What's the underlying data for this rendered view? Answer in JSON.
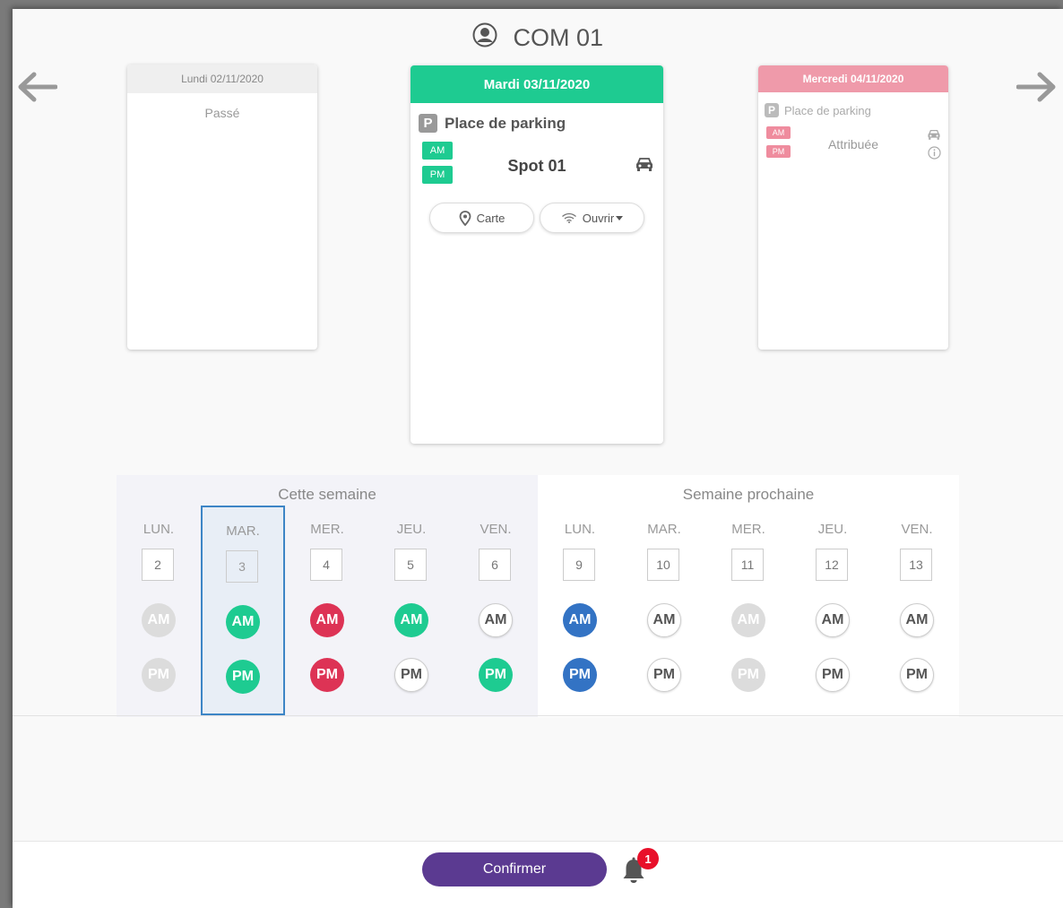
{
  "header": {
    "title": "COM 01",
    "icon": "user-circle-icon"
  },
  "cards": {
    "past": {
      "date": "Lundi 02/11/2020",
      "label": "Passé"
    },
    "current": {
      "date": "Mardi 03/11/2020",
      "service_icon": "P",
      "service": "Place de parking",
      "am": "AM",
      "pm": "PM",
      "spot": "Spot 01",
      "carte_label": "Carte",
      "ouvrir_label": "Ouvrir"
    },
    "next": {
      "date": "Mercredi 04/11/2020",
      "service_icon": "P",
      "service": "Place de parking",
      "am": "AM",
      "pm": "PM",
      "status": "Attribuée"
    }
  },
  "calendar": {
    "this_week": {
      "title": "Cette semaine",
      "days": [
        {
          "name": "LUN.",
          "num": "2",
          "am": "AM",
          "am_state": "past",
          "pm": "PM",
          "pm_state": "past"
        },
        {
          "name": "MAR.",
          "num": "3",
          "am": "AM",
          "am_state": "green",
          "pm": "PM",
          "pm_state": "green",
          "selected": true
        },
        {
          "name": "MER.",
          "num": "4",
          "am": "AM",
          "am_state": "red",
          "pm": "PM",
          "pm_state": "red"
        },
        {
          "name": "JEU.",
          "num": "5",
          "am": "AM",
          "am_state": "green",
          "pm": "PM",
          "pm_state": "empty"
        },
        {
          "name": "VEN.",
          "num": "6",
          "am": "AM",
          "am_state": "empty",
          "pm": "PM",
          "pm_state": "green"
        }
      ]
    },
    "next_week": {
      "title": "Semaine prochaine",
      "days": [
        {
          "name": "LUN.",
          "num": "9",
          "am": "AM",
          "am_state": "blue",
          "pm": "PM",
          "pm_state": "blue"
        },
        {
          "name": "MAR.",
          "num": "10",
          "am": "AM",
          "am_state": "empty",
          "pm": "PM",
          "pm_state": "empty"
        },
        {
          "name": "MER.",
          "num": "11",
          "am": "AM",
          "am_state": "disabled",
          "pm": "PM",
          "pm_state": "disabled"
        },
        {
          "name": "JEU.",
          "num": "12",
          "am": "AM",
          "am_state": "empty",
          "pm": "PM",
          "pm_state": "empty"
        },
        {
          "name": "VEN.",
          "num": "13",
          "am": "AM",
          "am_state": "empty",
          "pm": "PM",
          "pm_state": "empty"
        }
      ]
    }
  },
  "footer": {
    "confirm_label": "Confirmer",
    "notification_count": "1"
  },
  "colors": {
    "green": "#1ecb91",
    "red": "#dd3355",
    "blue": "#3373c4",
    "pink": "#ef9aaa",
    "purple": "#5b3a91",
    "badge_red": "#e8102a"
  }
}
